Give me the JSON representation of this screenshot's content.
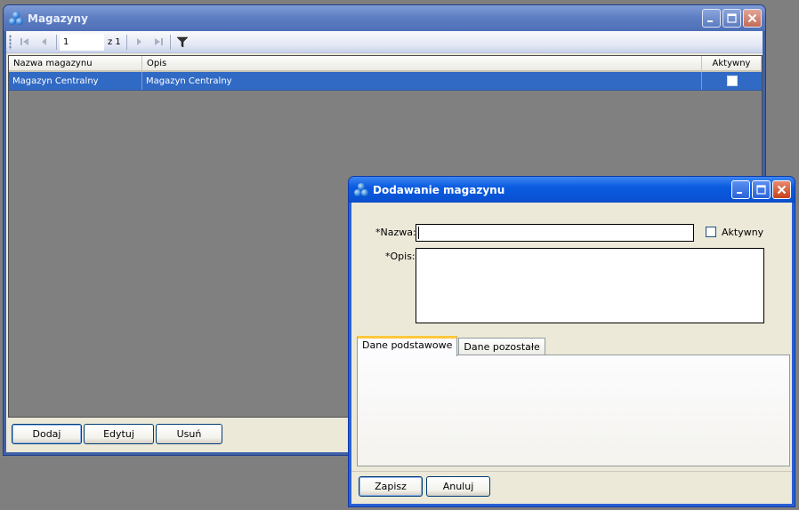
{
  "main_window": {
    "title": "Magazyny",
    "toolbar": {
      "position_value": "1",
      "position_of": "z 1",
      "icons": [
        "first-icon",
        "previous-icon",
        "next-icon",
        "last-icon",
        "filter-icon"
      ]
    },
    "grid": {
      "columns": [
        "Nazwa magazynu",
        "Opis",
        "Aktywny"
      ],
      "rows": [
        {
          "name": "Magazyn Centralny",
          "description": "Magazyn Centralny",
          "active": false
        }
      ],
      "selected_row_color": "#316ac5"
    },
    "buttons": {
      "add": "Dodaj",
      "edit": "Edytuj",
      "delete": "Usuń"
    }
  },
  "dialog": {
    "title": "Dodawanie magazynu",
    "name_label": "*Nazwa:",
    "name_value": "",
    "active_label": "Aktywny",
    "active_checked": false,
    "description_label": "*Opis:",
    "description_value": "",
    "tabs": [
      "Dane podstawowe",
      "Dane pozostałe"
    ],
    "active_tab": "Dane podstawowe",
    "buttons": {
      "save": "Zapisz",
      "cancel": "Anuluj"
    }
  },
  "colors": {
    "desktop": "#7f7f7f",
    "dialog_titlebar": "#0a5be0",
    "main_titlebar_inactive": "#5f7fc3",
    "window_face": "#ece9d8"
  }
}
